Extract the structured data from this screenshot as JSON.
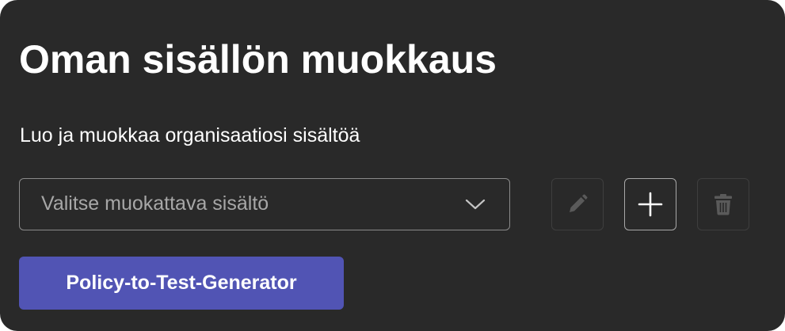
{
  "panel": {
    "title": "Oman sisällön muokkaus",
    "subtitle": "Luo ja muokkaa organisaatiosi sisältöä"
  },
  "content_select": {
    "placeholder": "Valitse muokattava sisältö",
    "icon": "chevron-down-icon"
  },
  "actions": {
    "edit": {
      "icon": "pencil-icon",
      "enabled": false
    },
    "add": {
      "icon": "plus-icon",
      "enabled": true
    },
    "delete": {
      "icon": "trash-icon",
      "enabled": false
    }
  },
  "primary_button": {
    "label": "Policy-to-Test-Generator"
  },
  "colors": {
    "background": "#292929",
    "text": "#ffffff",
    "placeholder": "#a7a7a7",
    "disabled_icon": "#5a5a5a",
    "accent": "#5154b4"
  }
}
